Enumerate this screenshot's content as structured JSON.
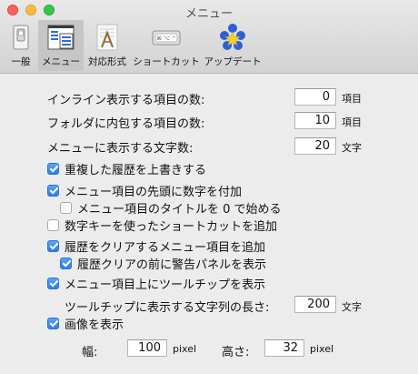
{
  "window": {
    "title": "メニュー"
  },
  "toolbar": {
    "tabs": [
      {
        "label": "一般",
        "icon": "general-switch-icon",
        "selected": false
      },
      {
        "label": "メニュー",
        "icon": "menu-icon",
        "selected": true
      },
      {
        "label": "対応形式",
        "icon": "formats-icon",
        "selected": false
      },
      {
        "label": "ショートカット",
        "icon": "keyboard-icon",
        "selected": false
      },
      {
        "label": "アップデート",
        "icon": "update-icon",
        "selected": false
      }
    ]
  },
  "settings": {
    "inline_items": {
      "label": "インライン表示する項目の数:",
      "value": "0",
      "unit": "項目"
    },
    "folder_items": {
      "label": "フォルダに内包する項目の数:",
      "value": "10",
      "unit": "項目"
    },
    "menu_chars": {
      "label": "メニューに表示する文字数:",
      "value": "20",
      "unit": "文字"
    },
    "checks": {
      "overwrite_history": {
        "label": "重複した履歴を上書きする",
        "checked": true
      },
      "number_prefix": {
        "label": "メニュー項目の先頭に数字を付加",
        "checked": true
      },
      "start_from_zero": {
        "label": "メニュー項目のタイトルを 0 で始める",
        "checked": false
      },
      "numeric_shortcuts": {
        "label": "数字キーを使ったショートカットを追加",
        "checked": false
      },
      "clear_history_item": {
        "label": "履歴をクリアするメニュー項目を追加",
        "checked": true
      },
      "clear_warning": {
        "label": "履歴クリアの前に警告パネルを表示",
        "checked": true
      },
      "show_tooltip": {
        "label": "メニュー項目上にツールチップを表示",
        "checked": true
      },
      "show_image": {
        "label": "画像を表示",
        "checked": true
      }
    },
    "tooltip_length": {
      "label": "ツールチップに表示する文字列の長さ:",
      "value": "200",
      "unit": "文字"
    },
    "image_width": {
      "label": "幅:",
      "value": "100",
      "unit": "pixel"
    },
    "image_height": {
      "label": "高さ:",
      "value": "32",
      "unit": "pixel"
    }
  },
  "colors": {
    "accent": "#2b7de9",
    "selected_tab": "#c6c6c6",
    "background": "#ececec"
  }
}
